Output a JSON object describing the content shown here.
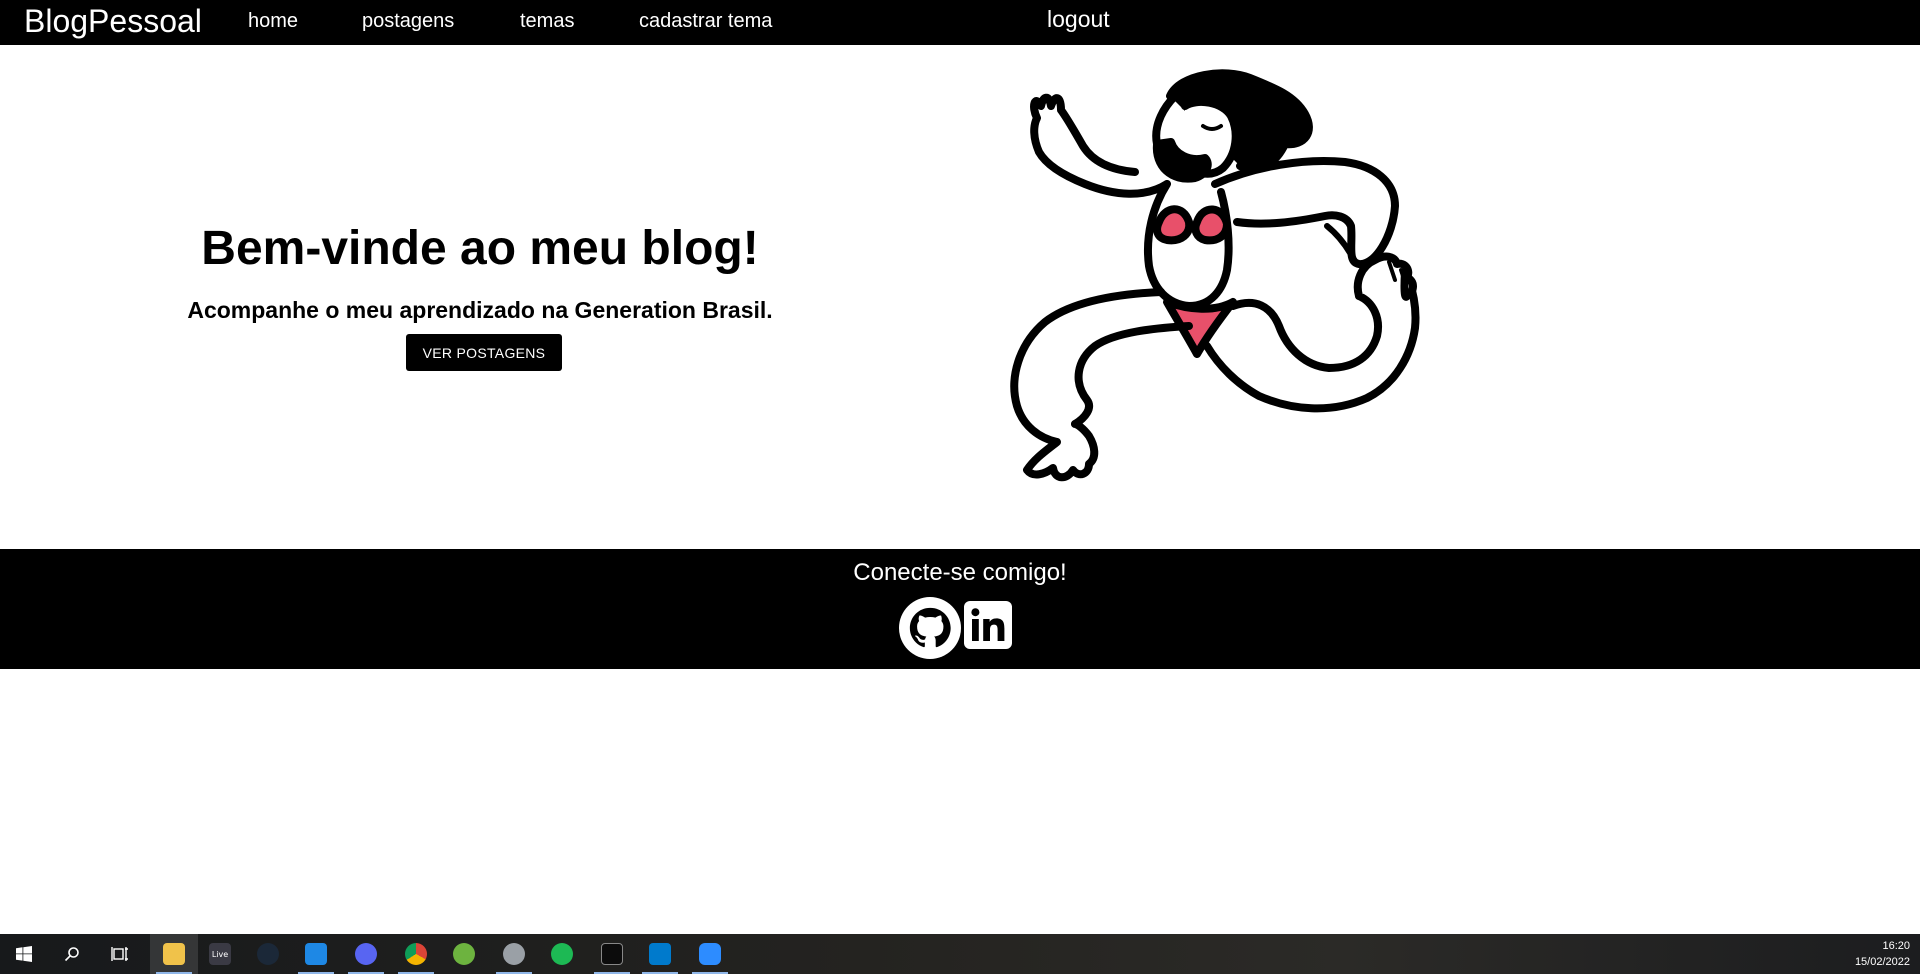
{
  "navbar": {
    "brand": "BlogPessoal",
    "links": [
      "home",
      "postagens",
      "temas",
      "cadastrar tema"
    ],
    "logout": "logout"
  },
  "hero": {
    "title": "Bem-vinde ao meu blog!",
    "subtitle": "Acompanhe o meu aprendizado na Generation Brasil.",
    "button": "VER POSTAGENS",
    "illustration": "dancing-person-illustration",
    "accent_color": "#e8506a"
  },
  "footer": {
    "title": "Conecte-se comigo!",
    "icons": [
      "github-icon",
      "linkedin-icon"
    ]
  },
  "taskbar": {
    "icons": [
      "windows-start-icon",
      "search-icon",
      "task-view-icon",
      "file-explorer-icon",
      "live-icon",
      "steam-icon",
      "mail-icon",
      "discord-icon",
      "chrome-icon",
      "spring-icon",
      "app-icon",
      "spotify-icon",
      "terminal-icon",
      "vscode-icon",
      "zoom-icon"
    ],
    "live_label": "Live",
    "time": "16:20",
    "date": "15/02/2022"
  }
}
